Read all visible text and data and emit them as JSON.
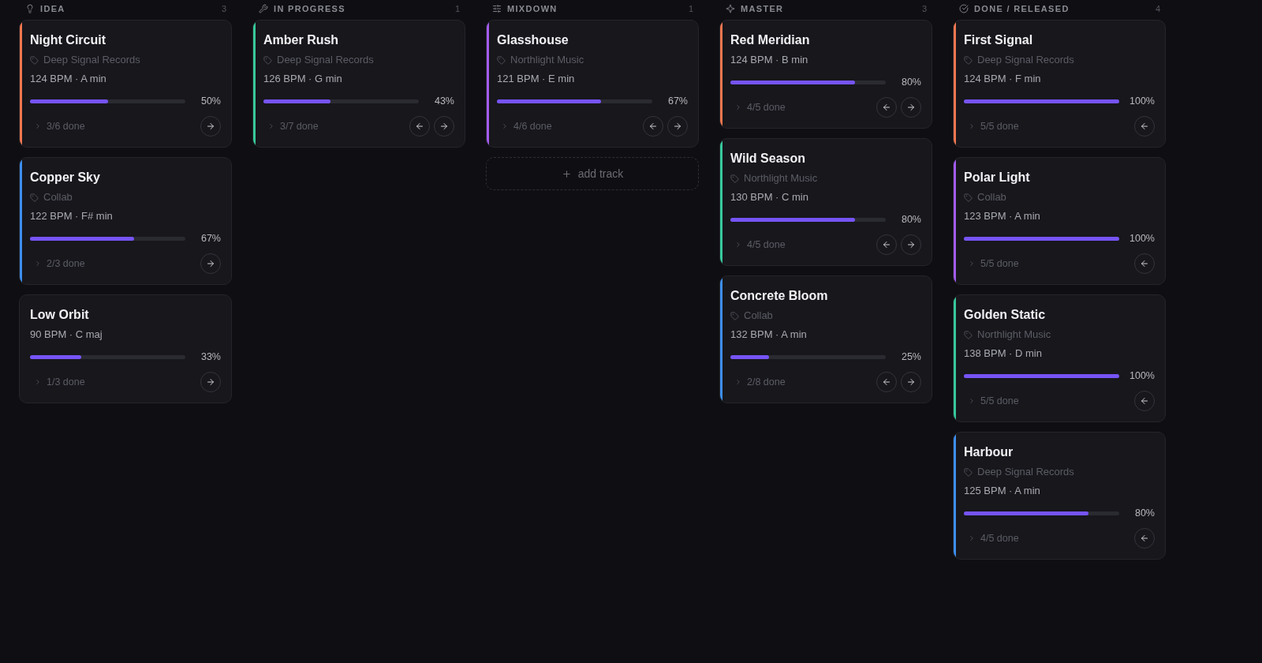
{
  "columns": [
    {
      "title": "IDEA",
      "count": "3",
      "cards": [
        {
          "title": "Night Circuit",
          "label": "Deep Signal Records",
          "meta": "124 BPM · A min",
          "level": 0.5,
          "percent": "50%",
          "done": "3/6 done",
          "color": "#f4774f",
          "can_move_back": false,
          "can_move_forward": true
        },
        {
          "title": "Copper Sky",
          "label": "Collab",
          "meta": "122 BPM · F# min",
          "level": 0.67,
          "percent": "67%",
          "done": "2/3 done",
          "color": "#3d8ff0",
          "can_move_back": false,
          "can_move_forward": true
        },
        {
          "title": "Low Orbit",
          "meta": "90 BPM · C maj",
          "level": 0.33,
          "percent": "33%",
          "done": "1/3 done",
          "can_move_back": false,
          "can_move_forward": true
        }
      ]
    },
    {
      "title": "IN PROGRESS",
      "count": "1",
      "cards": [
        {
          "title": "Amber Rush",
          "label": "Deep Signal Records",
          "meta": "126 BPM · G min",
          "level": 0.43,
          "percent": "43%",
          "done": "3/7 done",
          "color": "#37c99a",
          "can_move_back": true,
          "can_move_forward": true
        }
      ]
    },
    {
      "title": "MIXDOWN",
      "count": "1",
      "add_label": "add track",
      "cards": [
        {
          "title": "Glasshouse",
          "label": "Northlight Music",
          "meta": "121 BPM · E min",
          "level": 0.67,
          "percent": "67%",
          "done": "4/6 done",
          "color": "#a45bf0",
          "can_move_back": true,
          "can_move_forward": true
        }
      ]
    },
    {
      "title": "MASTER",
      "count": "3",
      "cards": [
        {
          "title": "Red Meridian",
          "meta": "124 BPM · B min",
          "level": 0.8,
          "percent": "80%",
          "done": "4/5 done",
          "color": "#f4774f",
          "can_move_back": true,
          "can_move_forward": true
        },
        {
          "title": "Wild Season",
          "label": "Northlight Music",
          "meta": "130 BPM · C min",
          "level": 0.8,
          "percent": "80%",
          "done": "4/5 done",
          "color": "#37c99a",
          "can_move_back": true,
          "can_move_forward": true
        },
        {
          "title": "Concrete Bloom",
          "label": "Collab",
          "meta": "132 BPM · A min",
          "level": 0.25,
          "percent": "25%",
          "done": "2/8 done",
          "color": "#3d8ff0",
          "can_move_back": true,
          "can_move_forward": true
        }
      ]
    },
    {
      "title": "DONE / RELEASED",
      "count": "4",
      "cards": [
        {
          "title": "First Signal",
          "label": "Deep Signal Records",
          "meta": "124 BPM · F min",
          "level": 1,
          "percent": "100%",
          "done": "5/5 done",
          "color": "#f4774f",
          "can_move_back": true,
          "can_move_forward": false
        },
        {
          "title": "Polar Light",
          "label": "Collab",
          "meta": "123 BPM · A min",
          "level": 1,
          "percent": "100%",
          "done": "5/5 done",
          "color": "#a45bf0",
          "can_move_back": true,
          "can_move_forward": false
        },
        {
          "title": "Golden Static",
          "label": "Northlight Music",
          "meta": "138 BPM · D min",
          "level": 1,
          "percent": "100%",
          "done": "5/5 done",
          "color": "#37c99a",
          "can_move_back": true,
          "can_move_forward": false
        },
        {
          "title": "Harbour",
          "label": "Deep Signal Records",
          "meta": "125 BPM · A min",
          "level": 0.8,
          "percent": "80%",
          "done": "4/5 done",
          "color": "#3d8ff0",
          "can_move_back": true,
          "can_move_forward": false
        }
      ]
    }
  ]
}
